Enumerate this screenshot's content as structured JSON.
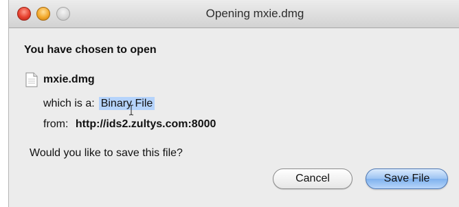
{
  "window": {
    "title": "Opening mxie.dmg"
  },
  "dialog": {
    "heading": "You have chosen to open",
    "file_name": "mxie.dmg",
    "file_icon": "document-icon",
    "type_label": "which is a:",
    "type_value": "Binary File",
    "from_label": "from:",
    "from_value": "http://ids2.zultys.com:8000",
    "question": "Would you like to save this file?"
  },
  "buttons": {
    "cancel_label": "Cancel",
    "save_label": "Save File"
  },
  "colors": {
    "close": "#e6402e",
    "minimize": "#f3a92c",
    "zoom": "#d6d6d6",
    "selection": "#b5d3fb",
    "default_button": "#9cc3f2"
  }
}
